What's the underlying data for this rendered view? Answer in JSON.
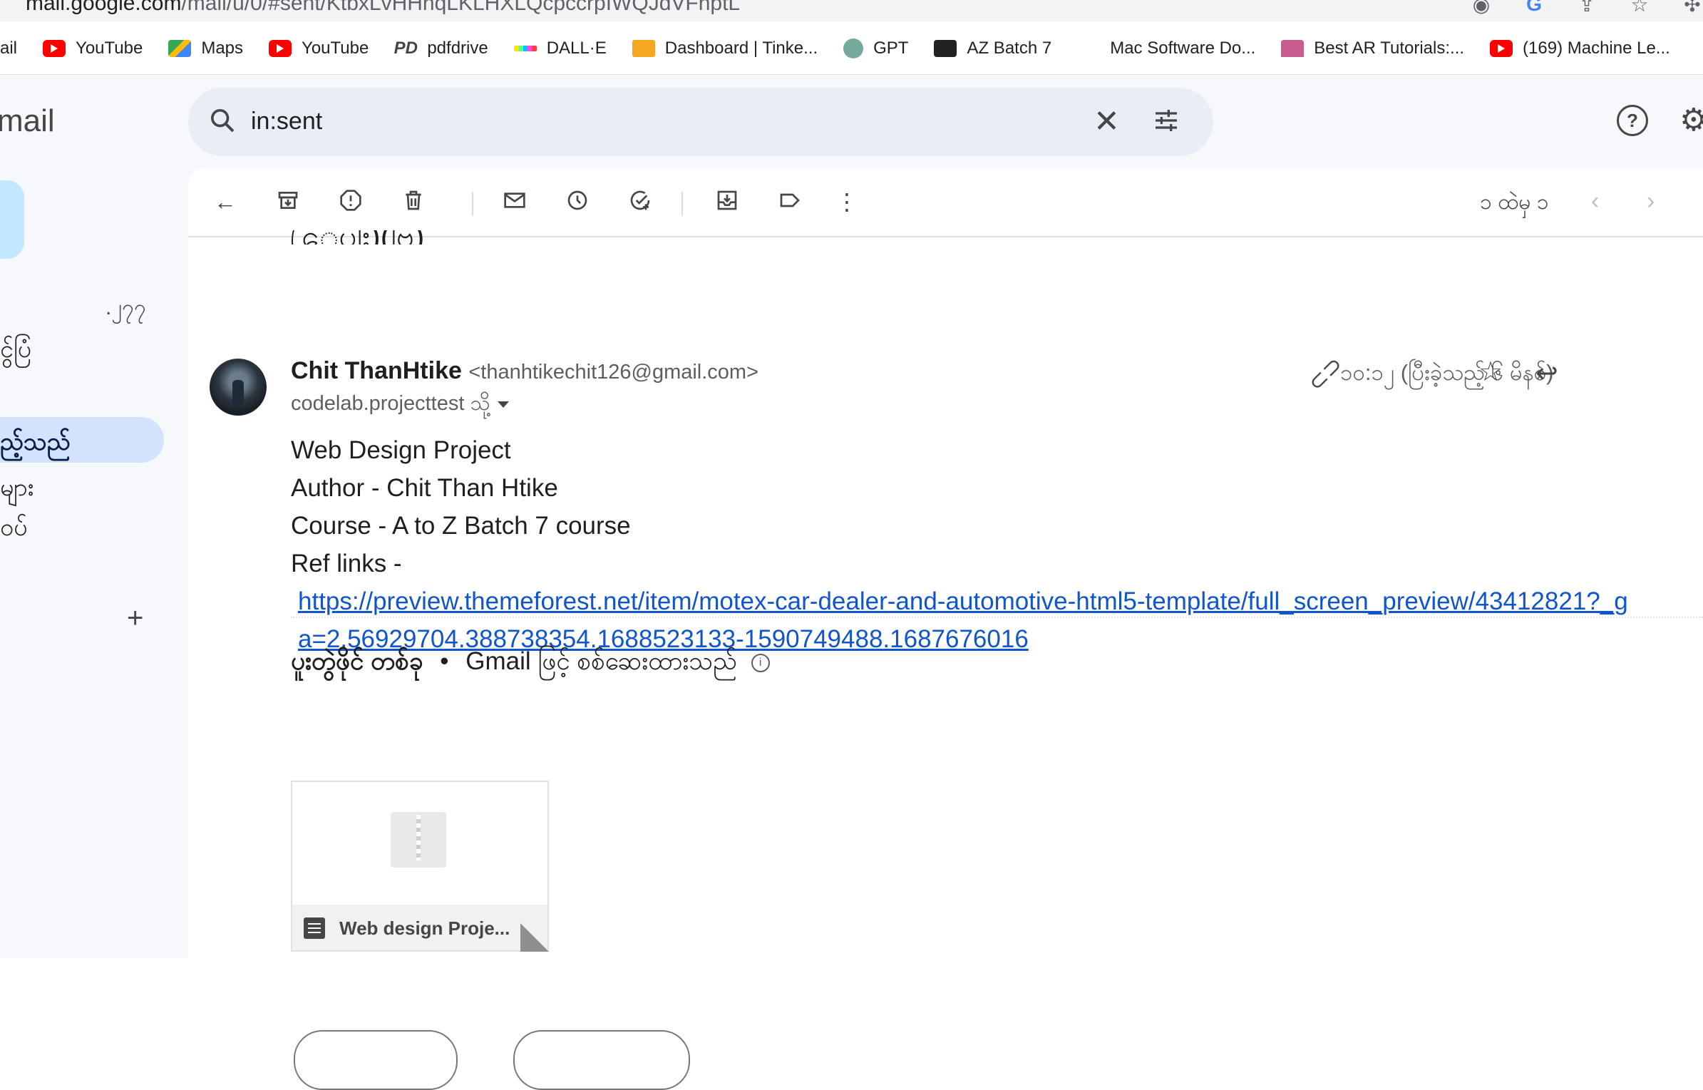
{
  "browser": {
    "url_host": "mail.google.com",
    "url_path": "/mail/u/0/#sent/KtbxLvHHhqLKLHXLQcpccrpIWQJdVFhptL",
    "bookmarks": [
      {
        "label": "ail",
        "icon": "none"
      },
      {
        "label": "YouTube",
        "icon": "youtube-icon"
      },
      {
        "label": "Maps",
        "icon": "maps-icon"
      },
      {
        "label": "YouTube",
        "icon": "youtube-icon"
      },
      {
        "label": "pdfdrive",
        "icon": "pdfdrive-icon"
      },
      {
        "label": "DALL·E",
        "icon": "dalle-icon"
      },
      {
        "label": "Dashboard | Tinke...",
        "icon": "tinkercad-icon"
      },
      {
        "label": "GPT",
        "icon": "gpt-icon"
      },
      {
        "label": "AZ Batch 7",
        "icon": "az-icon"
      },
      {
        "label": "Mac Software Do...",
        "icon": "apple-icon"
      },
      {
        "label": "Best AR Tutorials:...",
        "icon": "ar-icon"
      },
      {
        "label": "(169) Machine Le...",
        "icon": "youtube-icon"
      }
    ]
  },
  "app": {
    "brand": "mail",
    "search_value": "in:sent"
  },
  "nav": {
    "count": ".၂၇၇",
    "item1": "ငွ်ပြံ",
    "item_active": "ည့်သည်",
    "item3": "များ",
    "item4": "ဝပ်"
  },
  "toolbar": {
    "pager_text": "၁ ထဲမှ ၁"
  },
  "message": {
    "subject_fragment": "(ေပါး)(ဗြ)",
    "sender_name": "Chit ThanHtike",
    "sender_email": "<thanhtikechit126@gmail.com>",
    "to": "codelab.projecttest သို့",
    "time": "၁၀:၁၂ (ပြီးခဲ့သည့် ၆ မိနစ်)",
    "body_lines": [
      "Web Design Project",
      "Author - Chit Than Htike",
      "Course - A to Z Batch 7 course",
      "Ref links -"
    ],
    "link": "https://preview.themeforest.net/item/motex-car-dealer-and-automotive-html5-template/full_screen_preview/43412821?_ga=2.56929704.388738354.1688523133-1590749488.1687676016"
  },
  "attachments": {
    "count_label": "ပူးတွဲဖိုင် တစ်ခု",
    "separator": "•",
    "scan_note": "Gmail ဖြင့် စစ်ဆေးထားသည်",
    "file_name": "Web design Proje..."
  }
}
